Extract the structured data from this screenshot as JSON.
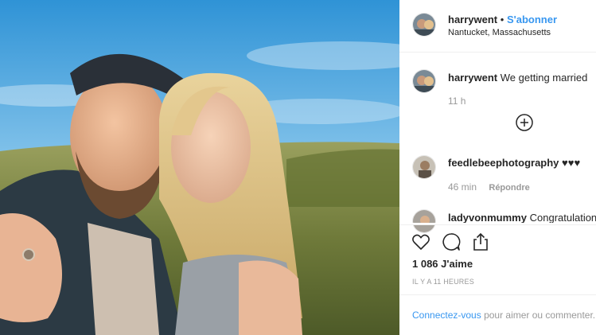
{
  "post": {
    "username": "harrywent",
    "separator": "•",
    "follow_label": "S'abonner",
    "location": "Nantucket, Massachusetts"
  },
  "caption": {
    "username": "harrywent",
    "text": "We getting married",
    "time": "11 h"
  },
  "comments": [
    {
      "username": "feedlebeephotography",
      "text": "♥♥♥",
      "time": "46 min",
      "reply_label": "Répondre"
    },
    {
      "username": "ladyvonmummy",
      "text": "Congratulations"
    }
  ],
  "actions": {
    "likes": "1 086 J'aime",
    "timestamp": "IL Y A 11 HEURES"
  },
  "login_prompt": {
    "link": "Connectez-vous",
    "text": "pour aimer ou commenter."
  },
  "colors": {
    "link": "#3897f0",
    "muted": "#999999",
    "text": "#262626"
  }
}
